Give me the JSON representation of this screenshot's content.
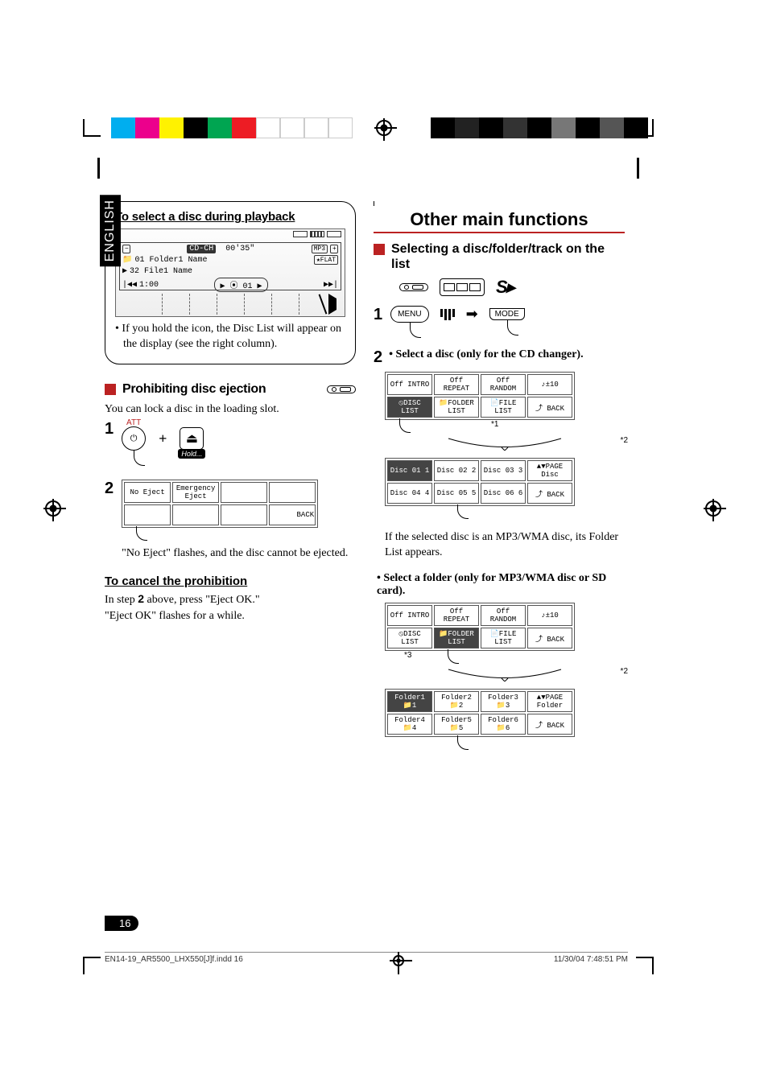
{
  "lang_tab": "ENGLISH",
  "crop_colors_left": [
    "#00aeef",
    "#ec008c",
    "#fff200",
    "#000000",
    "#00a551",
    "#ed1c24",
    "#ffffff",
    "#ffffff",
    "#ffffff",
    "#ffffff"
  ],
  "crop_colors_right": [
    "#000000",
    "#000000",
    "#000000",
    "#000000",
    "#000000",
    "#808080",
    "#000000",
    "#4d4d4d",
    "#000000"
  ],
  "left": {
    "box_title": "To select a disc during playback",
    "lcd": {
      "top_chip": "CD-CH",
      "time": "00'35\"",
      "mp3": "MP3",
      "folder_line": "01  Folder1 Name",
      "flat": "FLAT",
      "file_line": "32  File1 Name",
      "seek_time": "1:00",
      "track": "01"
    },
    "note": "If you hold the icon, the Disc List will appear on the display (see the right column).",
    "sec_title": "Prohibiting disc ejection",
    "sec_body": "You can lock a disc in the loading slot.",
    "att": "ATT",
    "hold": "Hold...",
    "step2_cells": {
      "a": "No Eject",
      "b": "Emergency Eject",
      "back": "BACK"
    },
    "step2_note": "\"No Eject\" flashes, and the disc cannot be ejected.",
    "cancel_title": "To cancel the prohibition",
    "cancel_body1": "In step ",
    "cancel_body1b": "2",
    "cancel_body1c": " above, press \"Eject OK.\"",
    "cancel_body2": "\"Eject OK\" flashes for a while."
  },
  "right": {
    "main_header": "Other main functions",
    "sub1": "Selecting a disc/folder/track on the list",
    "menu": "MENU",
    "mode": "MODE",
    "step2a": "Select a disc (only for the CD changer).",
    "panel1": {
      "r1": [
        "Off INTRO",
        "Off REPEAT",
        "Off RANDOM",
        "♪±10"
      ],
      "r2": [
        "⦸DISC LIST",
        "📁FOLDER LIST",
        "📄FILE LIST",
        "⤴ BACK"
      ],
      "ann1": "*1",
      "ann2": "*2",
      "r3": [
        "Disc 01  1",
        "Disc 02  2",
        "Disc 03  3",
        "▲▼PAGE Disc"
      ],
      "r4": [
        "Disc 04  4",
        "Disc 05  5",
        "Disc 06  6",
        "⤴ BACK"
      ]
    },
    "note1": "If the selected disc is an MP3/WMA disc, its Folder List appears.",
    "step2b": "Select a folder (only for MP3/WMA disc or SD card).",
    "panel2": {
      "r1": [
        "Off INTRO",
        "Off REPEAT",
        "Off RANDOM",
        "♪±10"
      ],
      "r2": [
        "⦸DISC LIST",
        "📁FOLDER LIST",
        "📄FILE LIST",
        "⤴ BACK"
      ],
      "ann3": "*3",
      "ann2": "*2",
      "r3": [
        "Folder1  📁1",
        "Folder2  📁2",
        "Folder3  📁3",
        "▲▼PAGE Folder"
      ],
      "r4": [
        "Folder4  📁4",
        "Folder5  📁5",
        "Folder6  📁6",
        "⤴ BACK"
      ]
    }
  },
  "page_number": "16",
  "footer": {
    "file": "EN14-19_AR5500_LHX550[J]f.indd   16",
    "date": "11/30/04   7:48:51 PM"
  }
}
